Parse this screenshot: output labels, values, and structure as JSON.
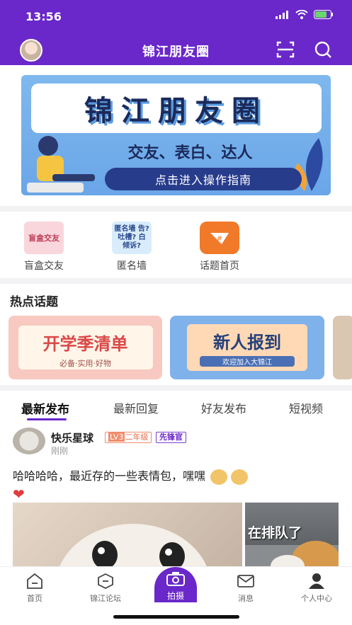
{
  "status": {
    "time": "13:56"
  },
  "header": {
    "title": "锦江朋友圈"
  },
  "banner": {
    "title": "锦江朋友圈",
    "subtitle": "交友、表白、达人",
    "button": "点击进入操作指南"
  },
  "quick_links": [
    {
      "label": "盲盒交友",
      "icon_text": "盲盒交友",
      "icon": "blind-box-icon",
      "bg": "#f9d6dc"
    },
    {
      "label": "匿名墙",
      "icon_text": "匿名墙 告?吐槽? 白 倾诉?",
      "icon": "anon-wall-icon",
      "bg": "#d9ecfb"
    },
    {
      "label": "话题首页",
      "icon_text": "#",
      "icon": "topic-icon",
      "bg": "#f07a2a"
    }
  ],
  "hot_topics": {
    "title": "热点话题",
    "cards": [
      {
        "title": "开学季清单",
        "subtitle": "必备·实用·好物",
        "bg": "#f7c9c1"
      },
      {
        "title": "新人报到",
        "subtitle": "欢迎加入大锦江",
        "bg": "#7fb2ea"
      }
    ]
  },
  "tabs": [
    "最新发布",
    "最新回复",
    "好友发布",
    "短视频"
  ],
  "active_tab": 0,
  "post": {
    "user": "快乐星球",
    "level": "LV3",
    "level_title": "二年级",
    "role": "先锋官",
    "time": "刚刚",
    "text": "哈哈哈哈，最近存的一些表情包，嘿嘿",
    "image2_caption": "在排队了"
  },
  "bottom_nav": [
    "首页",
    "锦江论坛",
    "拍摄",
    "消息",
    "个人中心"
  ],
  "colors": {
    "brand": "#6a27c9",
    "accent_orange": "#f07a2a"
  }
}
